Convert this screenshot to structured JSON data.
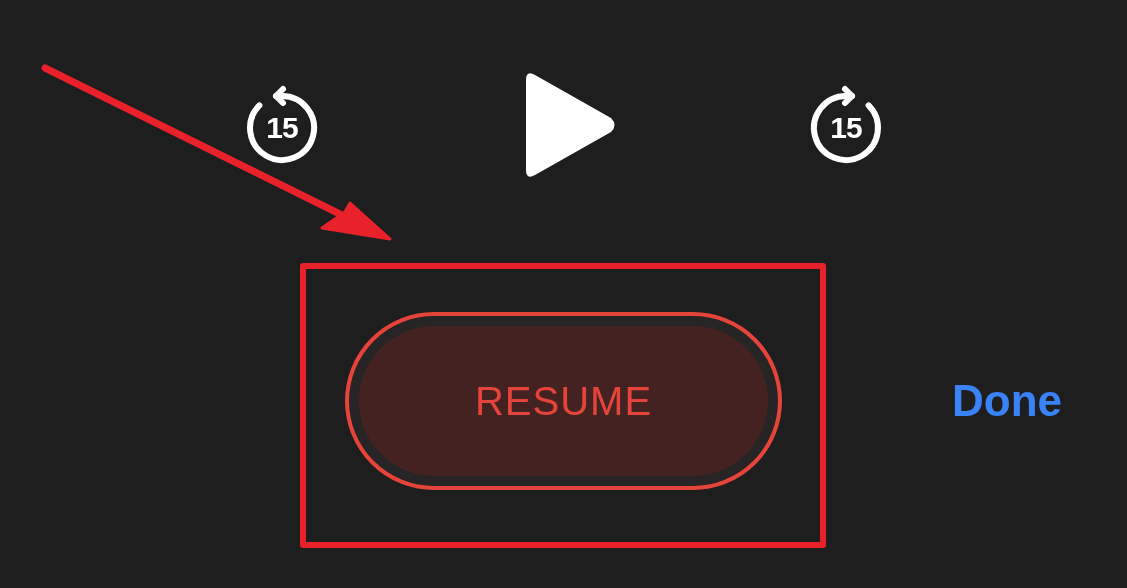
{
  "player_controls": [
    {
      "kind": "skip_back",
      "label": "15"
    },
    {
      "kind": "play"
    },
    {
      "kind": "skip_forward",
      "label": "15"
    }
  ],
  "resume_button": {
    "label": "RESUME"
  },
  "done_button": {
    "label": "Done"
  }
}
